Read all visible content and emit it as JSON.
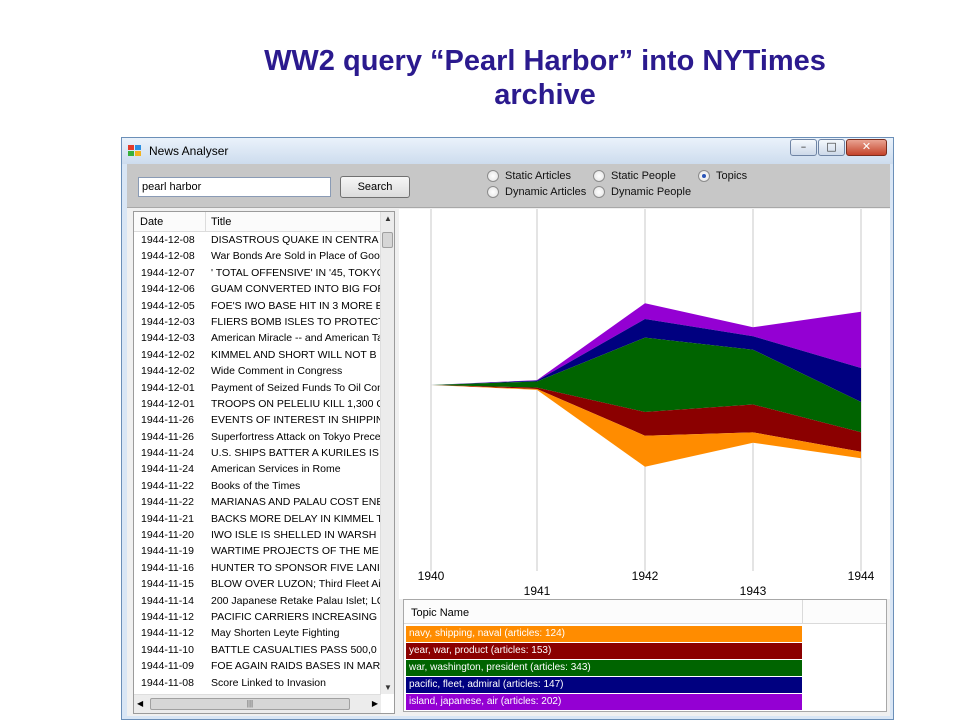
{
  "slide": {
    "title_line1": "WW2 query “Pearl Harbor” into NYTimes",
    "title_line2": "archive"
  },
  "window": {
    "title": "News Analyser",
    "buttons": [
      "–",
      "□",
      "✕"
    ]
  },
  "search": {
    "value": "pearl harbor",
    "button_label": "Search"
  },
  "view_options": [
    {
      "label": "Static Articles",
      "selected": false
    },
    {
      "label": "Dynamic Articles",
      "selected": false
    },
    {
      "label": "Static People",
      "selected": false
    },
    {
      "label": "Dynamic People",
      "selected": false
    },
    {
      "label": "Topics",
      "selected": true
    }
  ],
  "articles": {
    "columns": [
      "Date",
      "Title"
    ],
    "rows": [
      {
        "date": "1944-12-08",
        "title": "DISASTROUS QUAKE IN CENTRA"
      },
      {
        "date": "1944-12-08",
        "title": "War Bonds Are Sold in Place of Goo"
      },
      {
        "date": "1944-12-07",
        "title": "' TOTAL OFFENSIVE' IN '45, TOKYO"
      },
      {
        "date": "1944-12-06",
        "title": "GUAM CONVERTED INTO BIG FOR"
      },
      {
        "date": "1944-12-05",
        "title": "FOE'S IWO BASE HIT IN 3 MORE E"
      },
      {
        "date": "1944-12-03",
        "title": "FLIERS BOMB ISLES TO PROTECT"
      },
      {
        "date": "1944-12-03",
        "title": "American Miracle -- and American Ta"
      },
      {
        "date": "1944-12-02",
        "title": "KIMMEL AND SHORT WILL NOT B"
      },
      {
        "date": "1944-12-02",
        "title": "Wide Comment in Congress"
      },
      {
        "date": "1944-12-01",
        "title": "Payment of Seized Funds To Oil Con"
      },
      {
        "date": "1944-12-01",
        "title": "TROOPS ON PELELIU KILL 1,300 C"
      },
      {
        "date": "1944-11-26",
        "title": "EVENTS OF INTEREST IN SHIPPIN"
      },
      {
        "date": "1944-11-26",
        "title": "Superfortress Attack on Tokyo Prece"
      },
      {
        "date": "1944-11-24",
        "title": "U.S. SHIPS BATTER A KURILES IS"
      },
      {
        "date": "1944-11-24",
        "title": "American Services in Rome"
      },
      {
        "date": "1944-11-22",
        "title": "Books of the Times"
      },
      {
        "date": "1944-11-22",
        "title": "MARIANAS AND PALAU COST ENE"
      },
      {
        "date": "1944-11-21",
        "title": "BACKS MORE DELAY IN KIMMEL T"
      },
      {
        "date": "1944-11-20",
        "title": "IWO ISLE IS SHELLED IN WARSH"
      },
      {
        "date": "1944-11-19",
        "title": "WARTIME PROJECTS OF THE ME"
      },
      {
        "date": "1944-11-16",
        "title": "HUNTER TO SPONSOR FIVE LANI"
      },
      {
        "date": "1944-11-15",
        "title": "BLOW OVER LUZON; Third Fleet Ai"
      },
      {
        "date": "1944-11-14",
        "title": "200 Japanese Retake Palau Islet; LC"
      },
      {
        "date": "1944-11-12",
        "title": "PACIFIC CARRIERS INCREASING I"
      },
      {
        "date": "1944-11-12",
        "title": "May Shorten Leyte Fighting"
      },
      {
        "date": "1944-11-10",
        "title": "BATTLE CASUALTIES PASS 500,0"
      },
      {
        "date": "1944-11-09",
        "title": "FOE AGAIN RAIDS BASES IN MAR"
      },
      {
        "date": "1944-11-08",
        "title": "Score Linked to Invasion"
      }
    ]
  },
  "legend": {
    "header": "Topic Name"
  },
  "chart_data": {
    "type": "area",
    "x": [
      "1940",
      "1941",
      "1942",
      "1943",
      "1944"
    ],
    "xlabel": "",
    "ylabel": "",
    "grid": "vertical lines at each year",
    "series": [
      {
        "name": "island, japanese, air (articles: 202)",
        "color": "#9400d3",
        "values": [
          0,
          1,
          34,
          19,
          121
        ]
      },
      {
        "name": "pacific, fleet, admiral (articles: 147)",
        "color": "#000080",
        "values": [
          0,
          2,
          40,
          29,
          73
        ]
      },
      {
        "name": "war, washington, president (articles: 343)",
        "color": "#006400",
        "values": [
          0,
          13,
          160,
          118,
          65
        ]
      },
      {
        "name": "year, war, product (articles: 153)",
        "color": "#8b0000",
        "values": [
          0,
          3,
          51,
          60,
          42
        ]
      },
      {
        "name": "navy, shipping, naval (articles: 124)",
        "color": "#ff8c00",
        "values": [
          0,
          2,
          67,
          22,
          14
        ]
      }
    ]
  },
  "colors": {
    "slide_title": "#2b1a8e",
    "toolbar": "#c7c7c7"
  }
}
